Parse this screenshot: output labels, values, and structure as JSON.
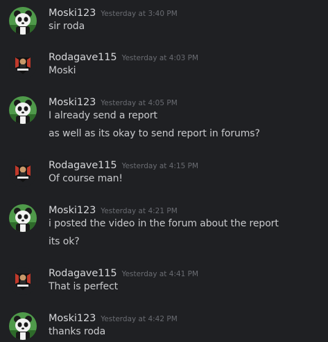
{
  "messages": [
    {
      "author": "Moski123",
      "timestamp": "Yesterday at 3:40 PM",
      "avatar_icon": "panda-avatar-icon",
      "lines": [
        "sir roda"
      ]
    },
    {
      "author": "Rodagave115",
      "timestamp": "Yesterday at 4:03 PM",
      "avatar_icon": "rodagave-logo-avatar-icon",
      "lines": [
        "Moski"
      ]
    },
    {
      "author": "Moski123",
      "timestamp": "Yesterday at 4:05 PM",
      "avatar_icon": "panda-avatar-icon",
      "lines": [
        "I already send a report",
        "as well as its okay to send report in forums?"
      ]
    },
    {
      "author": "Rodagave115",
      "timestamp": "Yesterday at 4:15 PM",
      "avatar_icon": "rodagave-logo-avatar-icon",
      "lines": [
        "Of course man!"
      ]
    },
    {
      "author": "Moski123",
      "timestamp": "Yesterday at 4:21 PM",
      "avatar_icon": "panda-avatar-icon",
      "lines": [
        "i posted the video in the forum about the report",
        "its ok?"
      ]
    },
    {
      "author": "Rodagave115",
      "timestamp": "Yesterday at 4:41 PM",
      "avatar_icon": "rodagave-logo-avatar-icon",
      "lines": [
        "That is perfect"
      ]
    },
    {
      "author": "Moski123",
      "timestamp": "Yesterday at 4:42 PM",
      "avatar_icon": "panda-avatar-icon",
      "lines": [
        "thanks roda"
      ]
    }
  ],
  "colors": {
    "background": "#1f2023",
    "author": "#d6d7da",
    "timestamp": "#6a6c72",
    "message_text": "#c9cacd",
    "panda_avatar_bg": "#4f9a4a",
    "rodagave_avatar_bg": "#111111",
    "rodagave_accent": "#c0392b"
  }
}
